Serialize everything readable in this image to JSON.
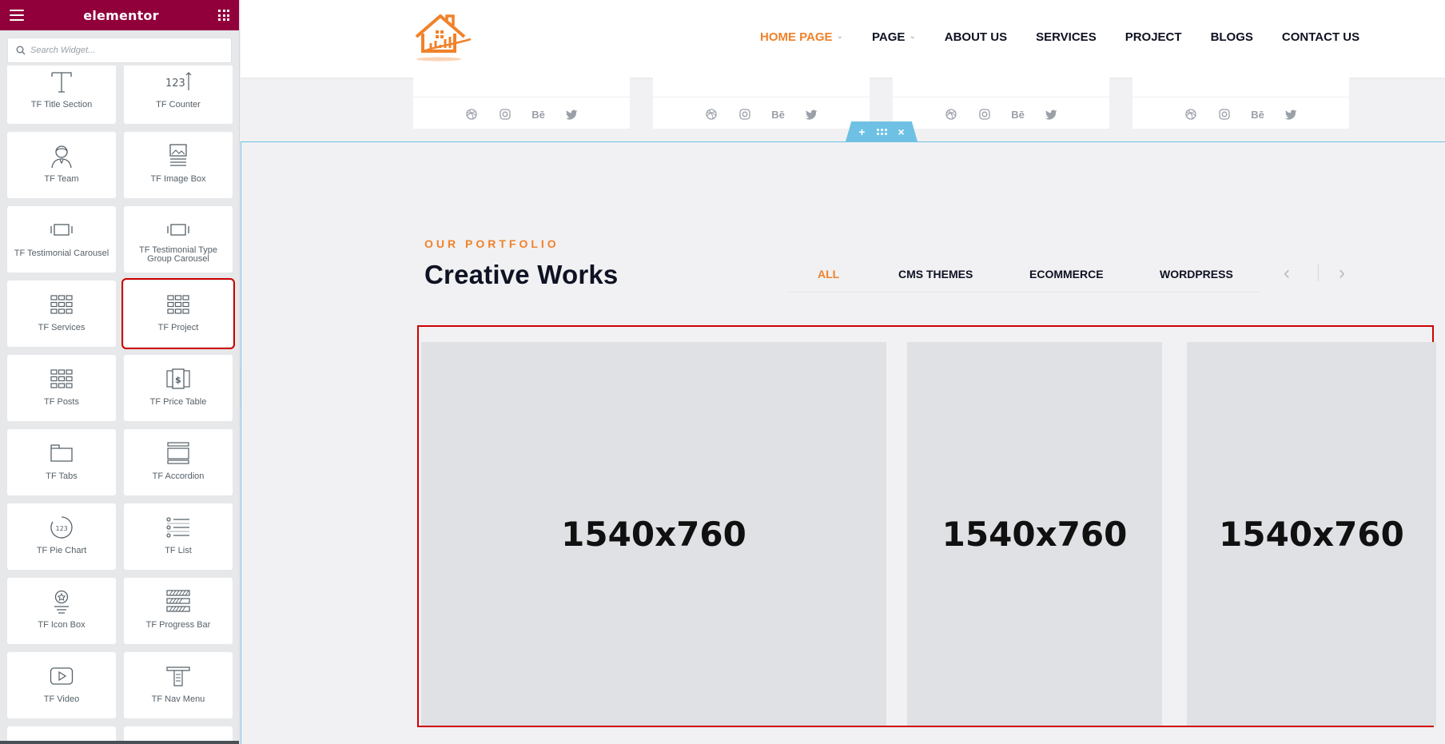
{
  "panel": {
    "brand": "elementor",
    "search_placeholder": "Search Widget...",
    "widgets": [
      {
        "label": "TF Title Section",
        "icon": "title-section-icon"
      },
      {
        "label": "TF Counter",
        "icon": "counter-icon"
      },
      {
        "label": "TF Team",
        "icon": "team-icon"
      },
      {
        "label": "TF Image Box",
        "icon": "image-box-icon"
      },
      {
        "label": "TF Testimonial Carousel",
        "icon": "testimonial-carousel-icon"
      },
      {
        "label": "TF Testimonial Type Group Carousel",
        "icon": "testimonial-group-carousel-icon"
      },
      {
        "label": "TF Services",
        "icon": "services-grid-icon"
      },
      {
        "label": "TF Project",
        "icon": "project-grid-icon",
        "selected": true
      },
      {
        "label": "TF Posts",
        "icon": "posts-grid-icon"
      },
      {
        "label": "TF Price Table",
        "icon": "price-table-icon"
      },
      {
        "label": "TF Tabs",
        "icon": "tabs-icon"
      },
      {
        "label": "TF Accordion",
        "icon": "accordion-icon"
      },
      {
        "label": "TF Pie Chart",
        "icon": "pie-chart-icon"
      },
      {
        "label": "TF List",
        "icon": "list-icon"
      },
      {
        "label": "TF Icon Box",
        "icon": "icon-box-icon"
      },
      {
        "label": "TF Progress Bar",
        "icon": "progress-bar-icon"
      },
      {
        "label": "TF Video",
        "icon": "video-icon"
      },
      {
        "label": "TF Nav Menu",
        "icon": "nav-menu-icon"
      }
    ]
  },
  "site": {
    "nav": [
      {
        "label": "HOME PAGE",
        "active": true,
        "dropdown": true
      },
      {
        "label": "PAGE",
        "dropdown": true
      },
      {
        "label": "ABOUT US"
      },
      {
        "label": "SERVICES"
      },
      {
        "label": "PROJECT"
      },
      {
        "label": "BLOGS"
      },
      {
        "label": "CONTACT US"
      }
    ],
    "social_labels": [
      "Bē"
    ],
    "portfolio": {
      "eyebrow": "OUR PORTFOLIO",
      "heading": "Creative Works",
      "filters": [
        "ALL",
        "CMS THEMES",
        "ECOMMERCE",
        "WORDPRESS"
      ],
      "cards": [
        "1540x760",
        "1540x760",
        "1540x760"
      ]
    }
  },
  "colors": {
    "panel_header": "#92003b",
    "accent": "#f0822a",
    "selection": "#d00000",
    "section_outline": "#6ec1e4"
  }
}
